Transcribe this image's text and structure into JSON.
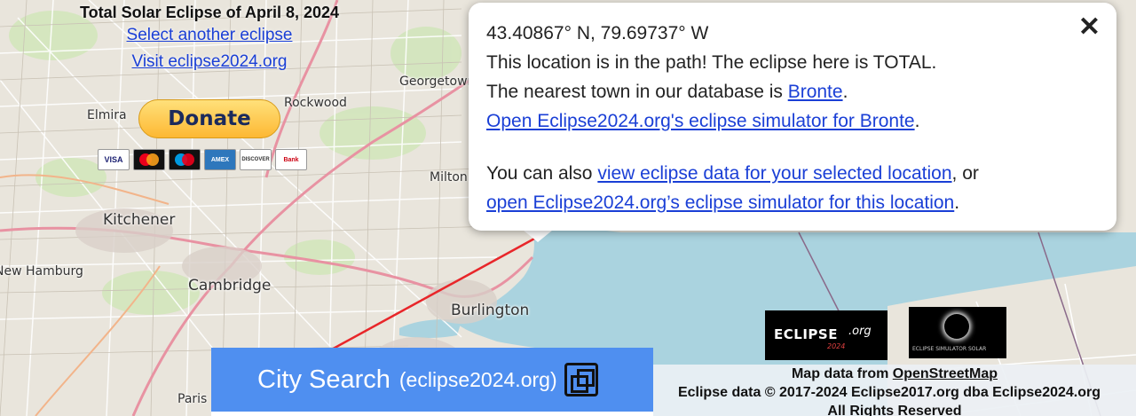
{
  "header": {
    "title": "Total Solar Eclipse of April 8, 2024",
    "link_select": "Select another eclipse",
    "link_visit": "Visit eclipse2024.org"
  },
  "donate": {
    "label": "Donate",
    "cards": [
      "VISA",
      "MC",
      "Maestro",
      "AMEX",
      "DISCOVER",
      "Bank"
    ]
  },
  "map": {
    "labels": [
      "Georgetown",
      "Rockwood",
      "Elmira",
      "Milton",
      "Kitchener",
      "New Hamburg",
      "Cambridge",
      "Burlington",
      "Paris"
    ],
    "colors": {
      "land": "#e9e5dc",
      "water": "#aad3df",
      "path_line": "#e8262a",
      "highway": "#e892a2"
    }
  },
  "popup": {
    "coords": "43.40867° N, 79.69737° W",
    "line2": "This location is in the path! The eclipse here is TOTAL.",
    "line3_prefix": "The nearest town in our database is ",
    "line3_link": "Bronte",
    "line3_suffix": ".",
    "line4_link": "Open Eclipse2024.org's eclipse simulator for Bronte",
    "line4_suffix": ".",
    "line5_prefix": "You can also ",
    "line5_link": "view eclipse data for your selected location",
    "line5_suffix": ", or",
    "line6_link": "open Eclipse2024.org’s eclipse simulator for this location",
    "line6_suffix": ".",
    "close": "✕"
  },
  "city_search": {
    "main": "City Search",
    "sub": "(eclipse2024.org)"
  },
  "logos": {
    "eclipse_org": "ECLIPSE",
    "eclipse_year": "2024",
    "eclipse_tld": ".org",
    "simulator": "ECLIPSE SIMULATOR SOLAR"
  },
  "attribution": {
    "line1_prefix": "Map data from ",
    "line1_link": "OpenStreetMap",
    "line2": "Eclipse data © 2017-2024 Eclipse2017.org dba Eclipse2024.org",
    "line3": "All Rights Reserved"
  }
}
